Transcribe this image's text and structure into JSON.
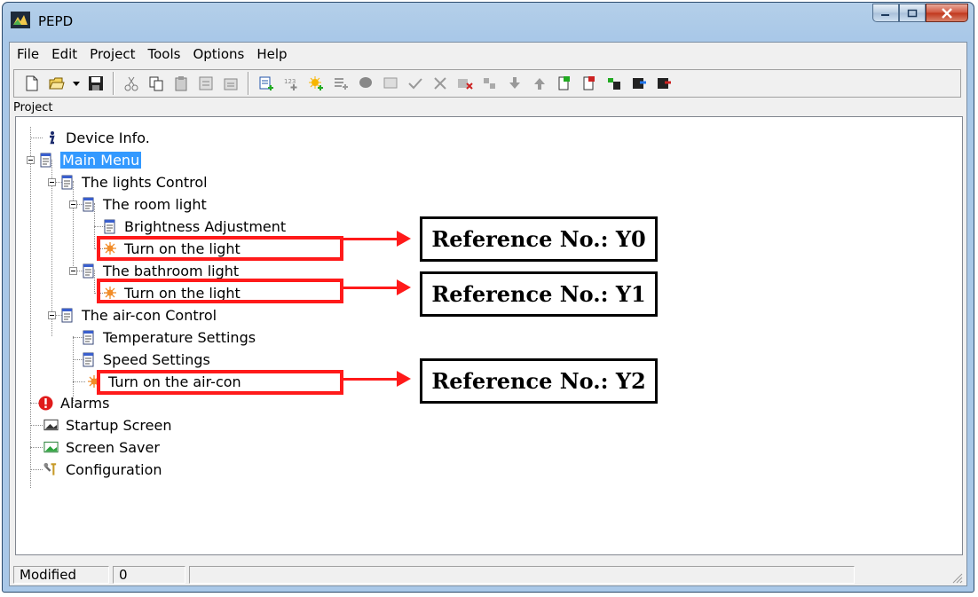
{
  "window": {
    "title": "PEPD"
  },
  "menu": [
    "File",
    "Edit",
    "Project",
    "Tools",
    "Options",
    "Help"
  ],
  "panel": {
    "title": "Project"
  },
  "tree": {
    "device_info": "Device Info.",
    "main_menu": "Main Menu",
    "lights_control": "The lights Control",
    "room_light": "The room light",
    "brightness": "Brightness Adjustment",
    "room_turn_on": "Turn on the light",
    "bathroom_light": "The bathroom light",
    "bathroom_turn_on": "Turn on the light",
    "aircon_control": "The air-con Control",
    "temperature": "Temperature Settings",
    "speed": "Speed Settings",
    "aircon_turn_on": "Turn on the air-con",
    "alarms": "Alarms",
    "startup_screen": "Startup Screen",
    "screen_saver": "Screen Saver",
    "configuration": "Configuration"
  },
  "status": {
    "state": "Modified",
    "value": "0"
  },
  "annotations": {
    "ref_y0": "Reference No.: Y0",
    "ref_y1": "Reference No.: Y1",
    "ref_y2": "Reference No.: Y2"
  },
  "colors": {
    "selection": "#3399ff",
    "highlight": "#ff1a1a"
  }
}
